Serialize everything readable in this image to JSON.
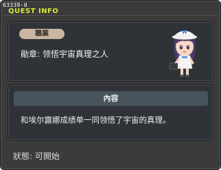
{
  "window": {
    "quest_id": "63339-0",
    "title": "QUEST INFO"
  },
  "info": {
    "job_label": "職業",
    "medal": "勛章: 领悟宇宙真理之人"
  },
  "content": {
    "header": "內容",
    "description": "和埃尔露娜成绩单一同领悟了宇宙的真理。"
  },
  "status": {
    "text": "狀態:  可開始"
  },
  "character": {
    "name": "npc-character",
    "colors": {
      "hair": "#4b3a6b",
      "cap": "#ffffff",
      "cap_logo": "#2a6fd6",
      "skin": "#f6d7c3",
      "outfit": "#f4f4f4"
    }
  }
}
